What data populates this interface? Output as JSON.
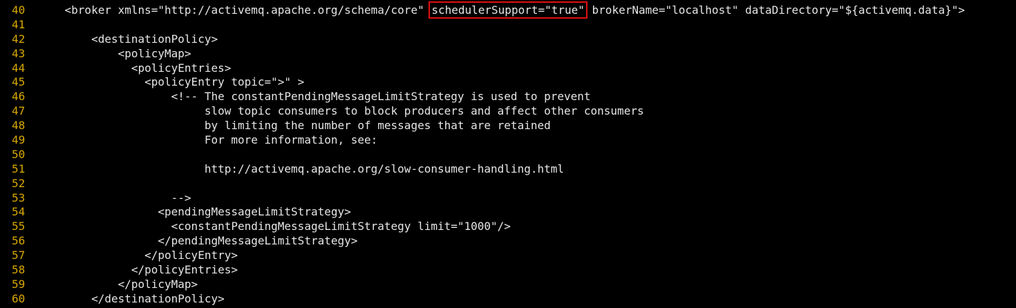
{
  "editor": {
    "colors": {
      "background": "#000000",
      "text": "#e6e6e6",
      "line_number": "#d8a800",
      "highlight_box": "#e01010"
    },
    "lines": [
      {
        "number": "40",
        "before": "    <broker xmlns=\"http://activemq.apache.org/schema/core\" ",
        "highlight": "schedulerSupport=\"true\"",
        "after": " brokerName=\"localhost\" dataDirectory=\"${activemq.data}\">"
      },
      {
        "number": "41",
        "text": ""
      },
      {
        "number": "42",
        "text": "        <destinationPolicy>"
      },
      {
        "number": "43",
        "text": "            <policyMap>"
      },
      {
        "number": "44",
        "text": "              <policyEntries>"
      },
      {
        "number": "45",
        "text": "                <policyEntry topic=\">\" >"
      },
      {
        "number": "46",
        "text": "                    <!-- The constantPendingMessageLimitStrategy is used to prevent"
      },
      {
        "number": "47",
        "text": "                         slow topic consumers to block producers and affect other consumers"
      },
      {
        "number": "48",
        "text": "                         by limiting the number of messages that are retained"
      },
      {
        "number": "49",
        "text": "                         For more information, see:"
      },
      {
        "number": "50",
        "text": ""
      },
      {
        "number": "51",
        "text": "                         http://activemq.apache.org/slow-consumer-handling.html"
      },
      {
        "number": "52",
        "text": ""
      },
      {
        "number": "53",
        "text": "                    -->"
      },
      {
        "number": "54",
        "text": "                  <pendingMessageLimitStrategy>"
      },
      {
        "number": "55",
        "text": "                    <constantPendingMessageLimitStrategy limit=\"1000\"/>"
      },
      {
        "number": "56",
        "text": "                  </pendingMessageLimitStrategy>"
      },
      {
        "number": "57",
        "text": "                </policyEntry>"
      },
      {
        "number": "58",
        "text": "              </policyEntries>"
      },
      {
        "number": "59",
        "text": "            </policyMap>"
      },
      {
        "number": "60",
        "text": "        </destinationPolicy>"
      }
    ]
  }
}
